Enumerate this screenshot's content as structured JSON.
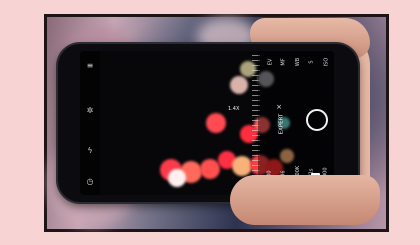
{
  "camera_ui": {
    "expert_label": "EXPERT",
    "close_glyph": "×",
    "zoom": "1.4X",
    "left_icons": [
      "menu-icon",
      "settings-icon",
      "flash-icon",
      "timer-icon"
    ],
    "columns": [
      {
        "top": "EV",
        "mid": "0.00"
      },
      {
        "top": "MF",
        "mid": "0.36"
      },
      {
        "top": "WB",
        "mid": "●5000K"
      },
      {
        "top": "S",
        "mid": "●1/1s"
      },
      {
        "top": "ISO",
        "mid": "●1000"
      }
    ]
  },
  "colors": {
    "background": "#f7d4d3",
    "frame": "#1e1416",
    "phone": "#0c0c10"
  }
}
